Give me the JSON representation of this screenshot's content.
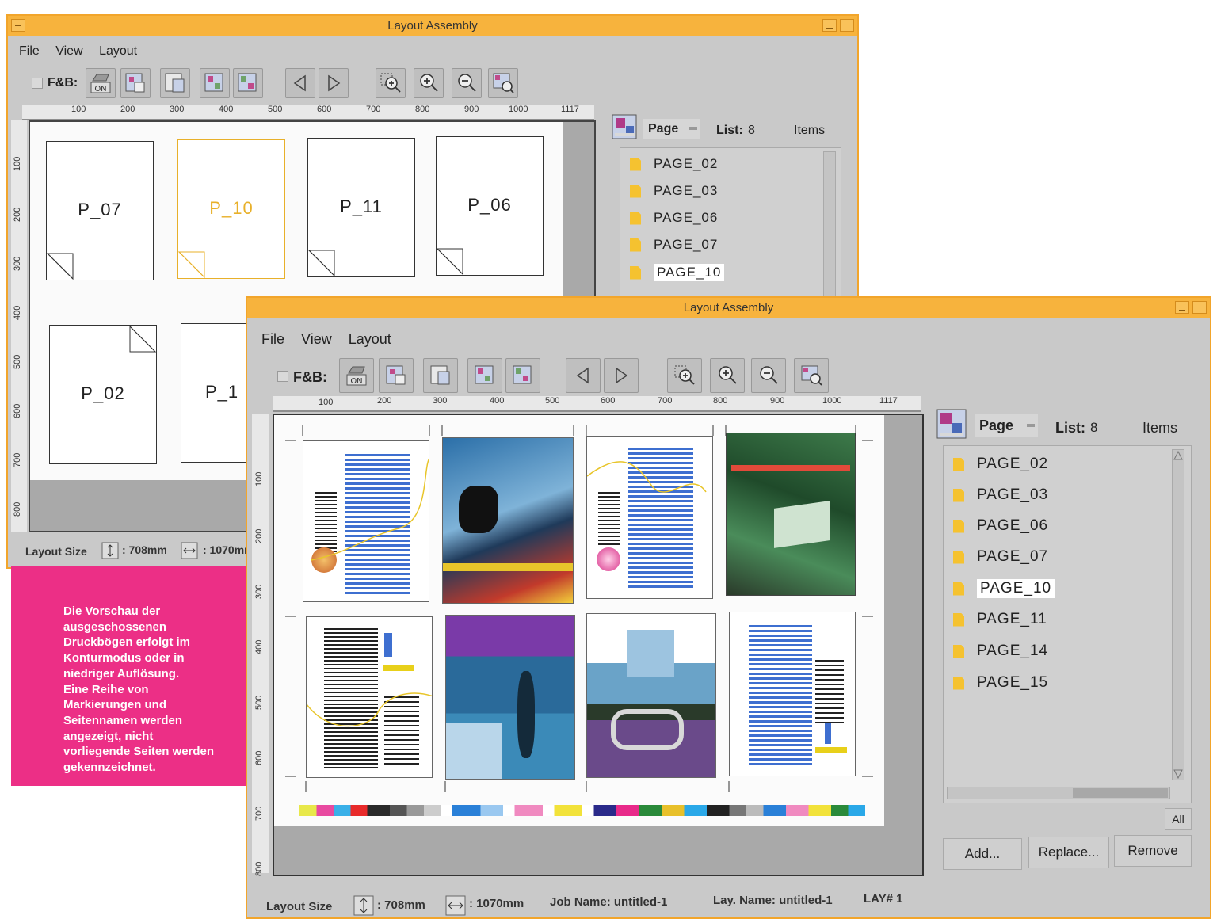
{
  "back_window": {
    "title": "Layout Assembly",
    "menu": [
      "File",
      "View",
      "Layout"
    ],
    "fb_label": "F&B:",
    "on_label": "ON",
    "ruler_h": [
      "100",
      "200",
      "300",
      "400",
      "500",
      "600",
      "700",
      "800",
      "900",
      "1000",
      "1117"
    ],
    "ruler_v": [
      "100",
      "200",
      "300",
      "400",
      "500",
      "600",
      "700",
      "800"
    ],
    "pages": [
      "P_07",
      "P_10",
      "P_11",
      "P_06",
      "P_02",
      "P_1"
    ],
    "panel": {
      "type_label": "Page",
      "list_label": "List:",
      "list_count": "8",
      "items_label": "Items"
    },
    "list_items": [
      "PAGE_02",
      "PAGE_03",
      "PAGE_06",
      "PAGE_07",
      "PAGE_10"
    ],
    "selected_item": "PAGE_10",
    "status": {
      "layout_size_label": "Layout Size",
      "height": ": 708mm",
      "width": ": 1070mm"
    }
  },
  "front_window": {
    "title": "Layout Assembly",
    "menu": [
      "File",
      "View",
      "Layout"
    ],
    "fb_label": "F&B:",
    "on_label": "ON",
    "ruler_h": [
      "100",
      "200",
      "300",
      "400",
      "500",
      "600",
      "700",
      "800",
      "900",
      "1000",
      "1117"
    ],
    "ruler_v": [
      "100",
      "200",
      "300",
      "400",
      "500",
      "600",
      "700",
      "800"
    ],
    "panel": {
      "type_label": "Page",
      "list_label": "List:",
      "list_count": "8",
      "items_label": "Items"
    },
    "list_items": [
      "PAGE_02",
      "PAGE_03",
      "PAGE_06",
      "PAGE_07",
      "PAGE_10",
      "PAGE_11",
      "PAGE_14",
      "PAGE_15"
    ],
    "selected_item": "PAGE_10",
    "all_label": "All",
    "buttons": {
      "add": "Add...",
      "replace": "Replace...",
      "remove": "Remove"
    },
    "status": {
      "layout_size_label": "Layout Size",
      "height": ": 708mm",
      "width": ": 1070mm",
      "job_name": "Job Name:  untitled-1",
      "lay_name": "Lay. Name:  untitled-1",
      "lay_num": "LAY# 1"
    }
  },
  "caption": {
    "lines": [
      "Die Vorschau der",
      "ausgeschossenen",
      "Druckbögen erfolgt im",
      "Konturmodus oder in",
      "niedriger Auflösung.",
      "Eine Reihe von",
      "Markierungen und",
      "Seitennamen werden",
      "angezeigt, nicht",
      "vorliegende Seiten werden",
      "gekennzeichnet."
    ]
  },
  "colors": {
    "title_bar": "#f7b33d",
    "window_border": "#f2a52b",
    "caption_bg": "#ec2f86",
    "highlight_page": "#e8b02a",
    "text_blue": "#3e6fd0"
  }
}
